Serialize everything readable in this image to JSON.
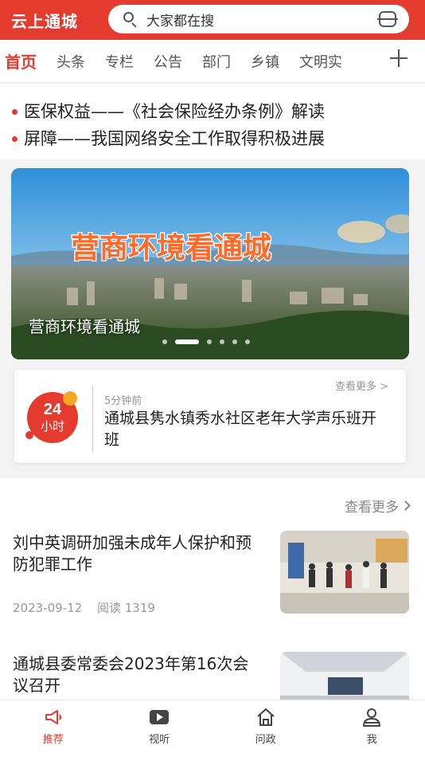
{
  "header": {
    "brand": "云上通城",
    "search_placeholder": "大家都在搜"
  },
  "nav": {
    "tabs": [
      "首页",
      "头条",
      "专栏",
      "公告",
      "部门",
      "乡镇",
      "文明实"
    ]
  },
  "ticker": {
    "items": [
      "医保权益——《社会保险经办条例》解读",
      "屏障——我国网络安全工作取得积极进展"
    ]
  },
  "banner": {
    "overlay_title": "营商环境看通城",
    "caption": "营商环境看通城",
    "slide_count": 6,
    "active_slide": 2
  },
  "card24": {
    "badge_number": "24",
    "badge_text": "小时",
    "more": "查看更多 >",
    "time": "5分钟前",
    "title": "通城县隽水镇秀水社区老年大学声乐班开班"
  },
  "news": {
    "more": "查看更多",
    "items": [
      {
        "title": "刘中英调研加强未成年人保护和预防犯罪工作",
        "date": "2023-09-12",
        "reads": "阅读 1319"
      },
      {
        "title": "通城县委常委会2023年第16次会议召开"
      }
    ]
  },
  "tabbar": {
    "items": [
      {
        "label": "推荐",
        "icon": "megaphone-icon",
        "active": true
      },
      {
        "label": "视听",
        "icon": "play-icon",
        "active": false
      },
      {
        "label": "问政",
        "icon": "home-icon",
        "active": false
      },
      {
        "label": "我",
        "icon": "user-icon",
        "active": false
      }
    ]
  },
  "colors": {
    "brand_red": "#e53a2e"
  }
}
